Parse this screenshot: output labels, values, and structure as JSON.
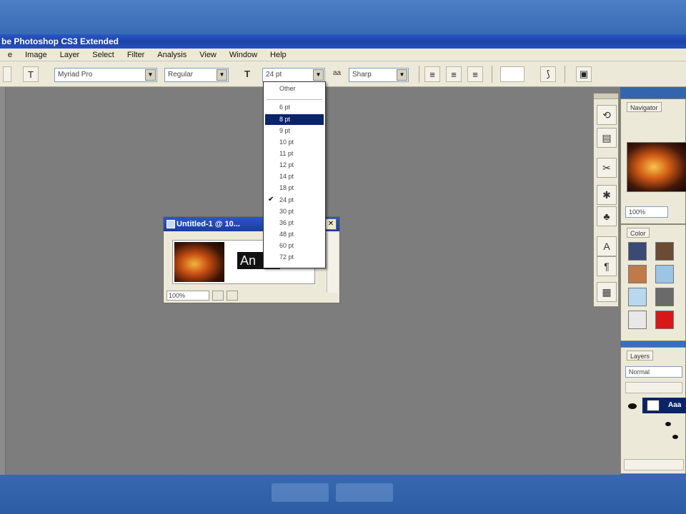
{
  "window": {
    "title": "be Photoshop CS3 Extended"
  },
  "menu": {
    "items": [
      "e",
      "Image",
      "Layer",
      "Select",
      "Filter",
      "Analysis",
      "View",
      "Window",
      "Help"
    ]
  },
  "options_bar": {
    "font_family": "Myriad Pro",
    "font_style": "Regular",
    "font_size": "24 pt",
    "antialias_label": "aa",
    "antialias": "Sharp",
    "size_icon_label": "T"
  },
  "font_size_dropdown": {
    "items": [
      "Other",
      "6 pt",
      "8 pt",
      "9 pt",
      "10 pt",
      "11 pt",
      "12 pt",
      "14 pt",
      "18 pt",
      "24 pt",
      "30 pt",
      "36 pt",
      "48 pt",
      "60 pt",
      "72 pt"
    ],
    "highlighted": "8 pt",
    "checked": "24 pt"
  },
  "document": {
    "title": "Untitled-1 @ 10...",
    "zoom": "100%",
    "sample_text": "An"
  },
  "navigator": {
    "tab": "Navigator",
    "zoom": "100%"
  },
  "color_palette": {
    "tab": "Color"
  },
  "layers_palette": {
    "tab": "Layers",
    "blend_mode": "Normal",
    "active_layer": "Aaa"
  },
  "colors": {
    "desktop_blue": "#3465ad",
    "title_blue": "#1c43a8",
    "selection_navy": "#0a246a",
    "workspace_gray": "#7d7d7d",
    "chrome_beige": "#ece9d8"
  }
}
